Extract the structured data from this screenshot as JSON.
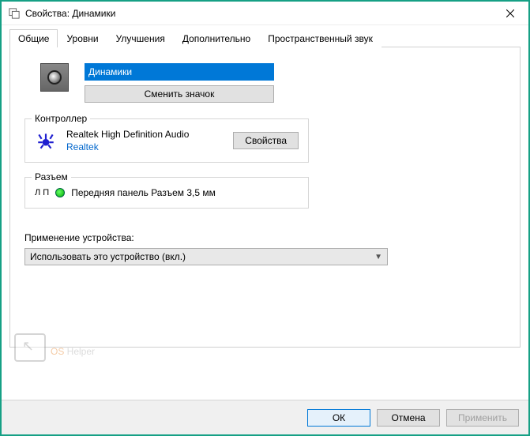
{
  "titlebar": {
    "title": "Свойства: Динамики"
  },
  "tabs": {
    "t0": "Общие",
    "t1": "Уровни",
    "t2": "Улучшения",
    "t3": "Дополнительно",
    "t4": "Пространственный звук"
  },
  "device": {
    "name": "Динамики",
    "change_icon_label": "Сменить значок"
  },
  "controller": {
    "group_title": "Контроллер",
    "name": "Realtek High Definition Audio",
    "vendor": "Realtek",
    "properties_label": "Свойства"
  },
  "jack": {
    "group_title": "Разъем",
    "lp": "Л П",
    "desc": "Передняя панель Разъем 3,5 мм"
  },
  "usage": {
    "label": "Применение устройства:",
    "selected": "Использовать это устройство (вкл.)"
  },
  "buttons": {
    "ok": "ОК",
    "cancel": "Отмена",
    "apply": "Применить"
  },
  "watermark": {
    "p1": "OS",
    "p2": " Helper"
  }
}
